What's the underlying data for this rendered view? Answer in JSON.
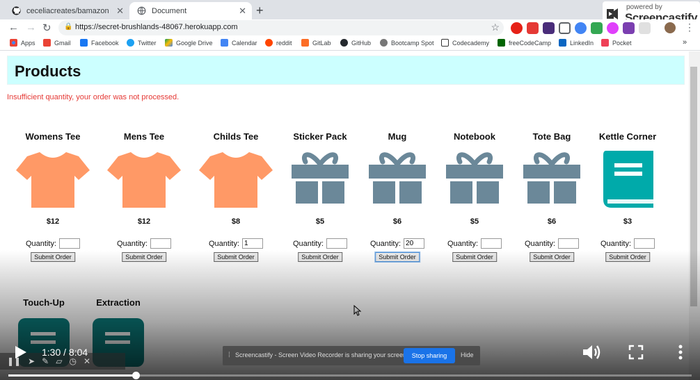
{
  "browser": {
    "tabs": [
      {
        "title": "ceceliacreates/bamazon",
        "icon": "github-icon",
        "active": false
      },
      {
        "title": "Document",
        "icon": "globe-icon",
        "active": true
      }
    ],
    "url": "https://secret-brushlands-48067.herokuapp.com",
    "bookmarks": [
      {
        "label": "Apps",
        "color": "#4285f4"
      },
      {
        "label": "Gmail",
        "color": "#ea4335"
      },
      {
        "label": "Facebook",
        "color": "#1877f2"
      },
      {
        "label": "Twitter",
        "color": "#1da1f2"
      },
      {
        "label": "Google Drive",
        "color": "#0f9d58"
      },
      {
        "label": "Calendar",
        "color": "#4285f4"
      },
      {
        "label": "reddit",
        "color": "#ff4500"
      },
      {
        "label": "GitLab",
        "color": "#fc6d26"
      },
      {
        "label": "GitHub",
        "color": "#24292e"
      },
      {
        "label": "Bootcamp Spot",
        "color": "#555555"
      },
      {
        "label": "Codecademy",
        "color": "#333333"
      },
      {
        "label": "freeCodeCamp",
        "color": "#006400"
      },
      {
        "label": "LinkedIn",
        "color": "#0a66c2"
      },
      {
        "label": "Pocket",
        "color": "#ef4056"
      }
    ],
    "bookmarks_more": "»",
    "extension_colors": [
      "#e62117",
      "#e53935",
      "#4a2d7a",
      "#5f6368",
      "#4285f4",
      "#34a853",
      "#e040fb",
      "#7b3fb0",
      "#bdbdbd"
    ]
  },
  "screencastify": {
    "powered_by": "powered by",
    "name": "Screencastify"
  },
  "page": {
    "title": "Products",
    "error": "Insufficient quantity, your order was not processed.",
    "quantity_label": "Quantity:",
    "submit_label": "Submit Order",
    "products": [
      {
        "name": "Womens Tee",
        "price": "$12",
        "qty": "",
        "icon": "tshirt-icon"
      },
      {
        "name": "Mens Tee",
        "price": "$12",
        "qty": "",
        "icon": "tshirt-icon"
      },
      {
        "name": "Childs Tee",
        "price": "$8",
        "qty": "1",
        "icon": "tshirt-icon"
      },
      {
        "name": "Sticker Pack",
        "price": "$5",
        "qty": "",
        "icon": "gift-icon"
      },
      {
        "name": "Mug",
        "price": "$6",
        "qty": "20",
        "icon": "gift-icon"
      },
      {
        "name": "Notebook",
        "price": "$5",
        "qty": "",
        "icon": "gift-icon"
      },
      {
        "name": "Tote Bag",
        "price": "$6",
        "qty": "",
        "icon": "gift-icon"
      },
      {
        "name": "Kettle Corner",
        "price": "$3",
        "qty": "",
        "icon": "book-icon"
      },
      {
        "name": "Touch-Up",
        "icon": "chat-icon"
      },
      {
        "name": "Extraction",
        "icon": "chat-icon"
      }
    ],
    "colors": {
      "tshirt": "#ff9966",
      "gift": "#6b8899",
      "book": "#00aaaa",
      "chat": "#0b7a7a",
      "header_bg": "#ccffff",
      "error": "#e53935"
    }
  },
  "share_bar": {
    "text": "Screencastify - Screen Video Recorder is sharing your screen.",
    "stop_label": "Stop sharing",
    "hide_label": "Hide"
  },
  "video": {
    "time": "1:30 / 8:04",
    "progress_fraction": 0.186
  }
}
